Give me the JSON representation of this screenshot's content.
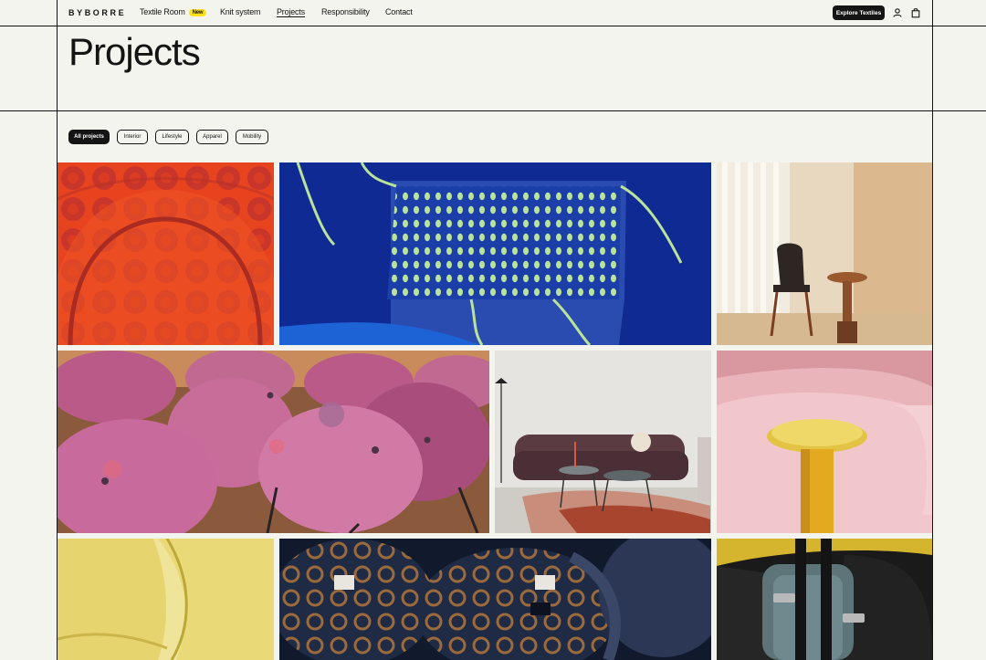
{
  "brand": {
    "logo": "BYBORRE"
  },
  "nav": {
    "links": [
      {
        "label": "Textile Room",
        "badge": "New"
      },
      {
        "label": "Knit system"
      },
      {
        "label": "Projects"
      },
      {
        "label": "Responsibility"
      },
      {
        "label": "Contact"
      }
    ],
    "active": "Projects",
    "cta": "Explore Textiles",
    "icons": [
      "user-icon",
      "bag-icon"
    ]
  },
  "page": {
    "title": "Projects"
  },
  "filters": {
    "items": [
      "All projects",
      "Interior",
      "Lifestyle",
      "Apparel",
      "Mobility"
    ],
    "selected": "All projects"
  },
  "tiles": [
    {
      "subject": "red-circle-knit-chair"
    },
    {
      "subject": "blue-dot-knit-textile"
    },
    {
      "subject": "black-chair-side-table"
    },
    {
      "subject": "pink-knit-chairs"
    },
    {
      "subject": "patterned-sofa-living-room"
    },
    {
      "subject": "pink-sofa-yellow-table"
    },
    {
      "subject": "yellow-upholstery"
    },
    {
      "subject": "navy-knit-bags"
    },
    {
      "subject": "car-seat-teal-strap"
    }
  ],
  "colors": {
    "background": "#f4f4ef",
    "ink": "#141414",
    "badge": "#ffe11a"
  }
}
